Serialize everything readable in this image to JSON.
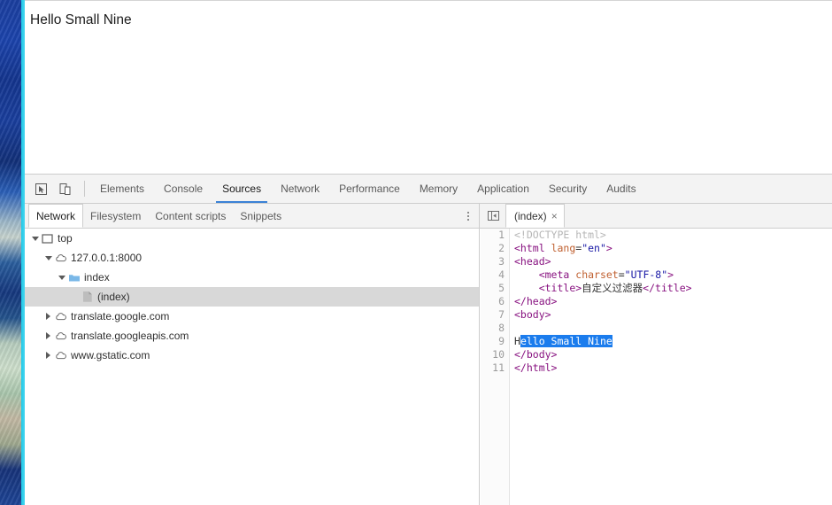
{
  "page": {
    "heading": "Hello Small Nine"
  },
  "devtools": {
    "toolbar": {
      "inspect_icon": "inspect-cursor-icon",
      "device_icon": "device-toolbar-icon",
      "tabs": [
        {
          "label": "Elements",
          "active": false
        },
        {
          "label": "Console",
          "active": false
        },
        {
          "label": "Sources",
          "active": true
        },
        {
          "label": "Network",
          "active": false
        },
        {
          "label": "Performance",
          "active": false
        },
        {
          "label": "Memory",
          "active": false
        },
        {
          "label": "Application",
          "active": false
        },
        {
          "label": "Security",
          "active": false
        },
        {
          "label": "Audits",
          "active": false
        }
      ]
    },
    "navigator": {
      "subtabs": [
        {
          "label": "Network",
          "active": true
        },
        {
          "label": "Filesystem",
          "active": false
        },
        {
          "label": "Content scripts",
          "active": false
        },
        {
          "label": "Snippets",
          "active": false
        }
      ],
      "more_icon": "kebab-menu-icon",
      "tree": [
        {
          "label": "top",
          "indent": 0,
          "twisty": "open",
          "icon": "frame-icon",
          "selected": false
        },
        {
          "label": "127.0.0.1:8000",
          "indent": 1,
          "twisty": "open",
          "icon": "cloud-icon",
          "selected": false
        },
        {
          "label": "index",
          "indent": 2,
          "twisty": "open",
          "icon": "folder-icon",
          "selected": false
        },
        {
          "label": "(index)",
          "indent": 3,
          "twisty": "none",
          "icon": "document-icon",
          "selected": true
        },
        {
          "label": "translate.google.com",
          "indent": 1,
          "twisty": "closed",
          "icon": "cloud-icon",
          "selected": false
        },
        {
          "label": "translate.googleapis.com",
          "indent": 1,
          "twisty": "closed",
          "icon": "cloud-icon",
          "selected": false
        },
        {
          "label": "www.gstatic.com",
          "indent": 1,
          "twisty": "closed",
          "icon": "cloud-icon",
          "selected": false
        }
      ]
    },
    "editor": {
      "navigator_toggle_icon": "show-navigator-icon",
      "file_tab": {
        "label": "(index)",
        "close_label": "×"
      },
      "line_numbers": [
        "1",
        "2",
        "3",
        "4",
        "5",
        "6",
        "7",
        "8",
        "9",
        "10",
        "11"
      ],
      "code_lines": [
        [
          {
            "t": "<!DOCTYPE html>",
            "c": "tok-doctype"
          }
        ],
        [
          {
            "t": "<html",
            "c": "tok-tag"
          },
          {
            "t": " ",
            "c": "tok-text"
          },
          {
            "t": "lang",
            "c": "tok-attr"
          },
          {
            "t": "=",
            "c": "tok-text"
          },
          {
            "t": "\"en\"",
            "c": "tok-val"
          },
          {
            "t": ">",
            "c": "tok-tag"
          }
        ],
        [
          {
            "t": "<head>",
            "c": "tok-tag"
          }
        ],
        [
          {
            "t": "    ",
            "c": "tok-text"
          },
          {
            "t": "<meta",
            "c": "tok-tag"
          },
          {
            "t": " ",
            "c": "tok-text"
          },
          {
            "t": "charset",
            "c": "tok-attr"
          },
          {
            "t": "=",
            "c": "tok-text"
          },
          {
            "t": "\"UTF-8\"",
            "c": "tok-val"
          },
          {
            "t": ">",
            "c": "tok-tag"
          }
        ],
        [
          {
            "t": "    ",
            "c": "tok-text"
          },
          {
            "t": "<title>",
            "c": "tok-tag"
          },
          {
            "t": "自定义过滤器",
            "c": "tok-cjk"
          },
          {
            "t": "</title>",
            "c": "tok-tag"
          }
        ],
        [
          {
            "t": "</head>",
            "c": "tok-tag"
          }
        ],
        [
          {
            "t": "<body>",
            "c": "tok-tag"
          }
        ],
        [
          {
            "t": "",
            "c": "tok-text"
          }
        ],
        [
          {
            "t": "H",
            "c": "tok-text"
          },
          {
            "t": "ello Small Nine",
            "c": "tok-text sel"
          }
        ],
        [
          {
            "t": "</body>",
            "c": "tok-tag"
          }
        ],
        [
          {
            "t": "</html>",
            "c": "tok-tag"
          }
        ]
      ]
    }
  }
}
